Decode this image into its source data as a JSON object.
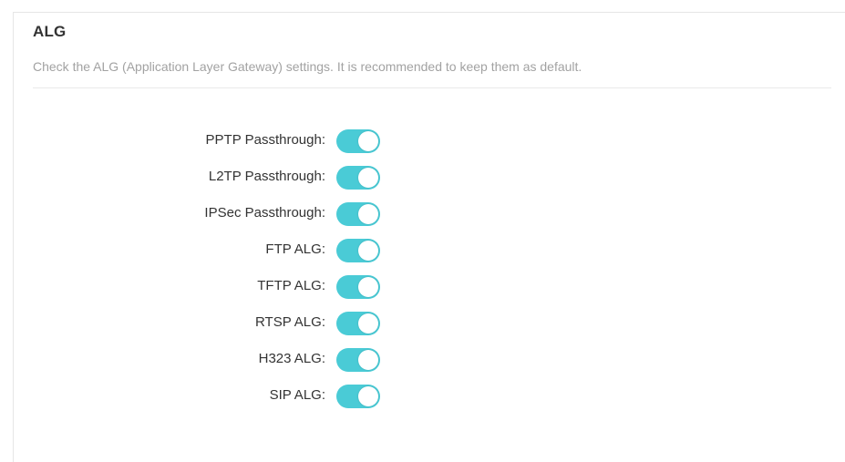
{
  "section": {
    "title": "ALG",
    "description": "Check the ALG (Application Layer Gateway) settings. It is recommended to keep them as default."
  },
  "colors": {
    "toggle_on": "#4acbd6",
    "title_text": "#333333",
    "description_text": "#a2a2a2"
  },
  "settings": [
    {
      "label": "PPTP Passthrough:",
      "enabled": true
    },
    {
      "label": "L2TP Passthrough:",
      "enabled": true
    },
    {
      "label": "IPSec Passthrough:",
      "enabled": true
    },
    {
      "label": "FTP ALG:",
      "enabled": true
    },
    {
      "label": "TFTP ALG:",
      "enabled": true
    },
    {
      "label": "RTSP ALG:",
      "enabled": true
    },
    {
      "label": "H323 ALG:",
      "enabled": true
    },
    {
      "label": "SIP ALG:",
      "enabled": true
    }
  ]
}
